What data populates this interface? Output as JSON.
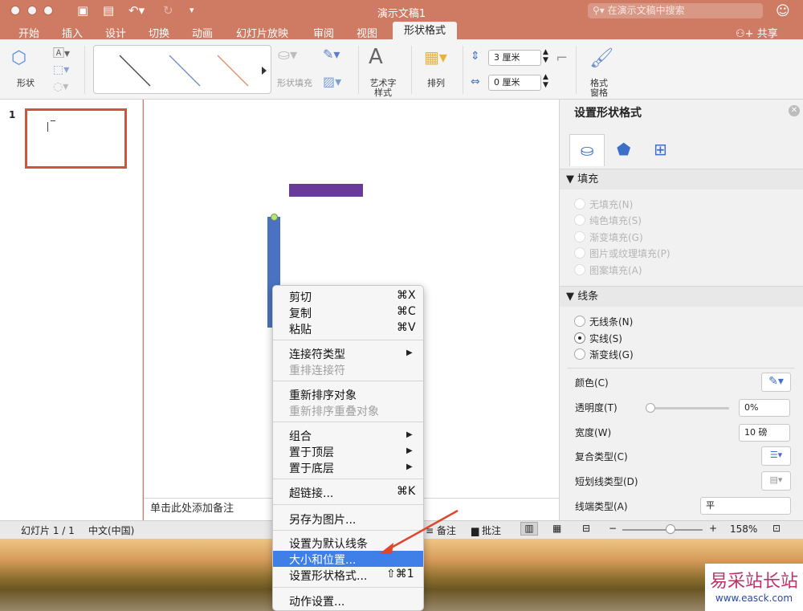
{
  "window": {
    "title": "演示文稿1",
    "search_placeholder": "在演示文稿中搜索"
  },
  "tabs": [
    "开始",
    "插入",
    "设计",
    "切换",
    "动画",
    "幻灯片放映",
    "审阅",
    "视图"
  ],
  "active_tab": "形状格式",
  "share_label": "共享",
  "ribbon": {
    "shape": "形状",
    "shape_fill": "形状填充",
    "wordart_1": "艺术字",
    "wordart_2": "样式",
    "arrange": "排列",
    "height": "3 厘米",
    "width": "0 厘米",
    "format_pane_1": "格式",
    "format_pane_2": "窗格"
  },
  "thumbnail": {
    "number": "1"
  },
  "notes_placeholder": "单击此处添加备注",
  "format_pane": {
    "title": "设置形状格式",
    "fill_section": "填充",
    "fill_options": [
      "无填充(N)",
      "纯色填充(S)",
      "渐变填充(G)",
      "图片或纹理填充(P)",
      "图案填充(A)"
    ],
    "line_section": "线条",
    "line_options": [
      "无线条(N)",
      "实线(S)",
      "渐变线(G)"
    ],
    "color_label": "颜色(C)",
    "transparency_label": "透明度(T)",
    "transparency_value": "0%",
    "width_label": "宽度(W)",
    "width_value": "10 磅",
    "compound_label": "复合类型(C)",
    "dash_label": "短划线类型(D)",
    "cap_label": "线端类型(A)",
    "cap_value": "平"
  },
  "context_menu": {
    "cut": "剪切",
    "cut_sc": "⌘X",
    "copy": "复制",
    "copy_sc": "⌘C",
    "paste": "粘贴",
    "paste_sc": "⌘V",
    "connector_type": "连接符类型",
    "reroute": "重排连接符",
    "reorder_objects": "重新排序对象",
    "reorder_overlap": "重新排序重叠对象",
    "group": "组合",
    "bring_front": "置于顶层",
    "send_back": "置于底层",
    "hyperlink": "超链接...",
    "hyperlink_sc": "⌘K",
    "save_picture": "另存为图片...",
    "set_default_line": "设置为默认线条",
    "size_position": "大小和位置...",
    "format_shape": "设置形状格式...",
    "format_shape_sc": "⇧⌘1",
    "action_settings": "动作设置..."
  },
  "status": {
    "slide": "幻灯片 1 / 1",
    "language": "中文(中国)",
    "notes": "备注",
    "comments": "批注",
    "zoom": "158%"
  },
  "watermark": {
    "text": "易采站长站",
    "url": "www.easck.com"
  },
  "colors": {
    "accent": "#cf7a62",
    "highlight": "#3e80e7",
    "shape_purple": "#6a3a98",
    "shape_blue": "#4a72c0"
  }
}
